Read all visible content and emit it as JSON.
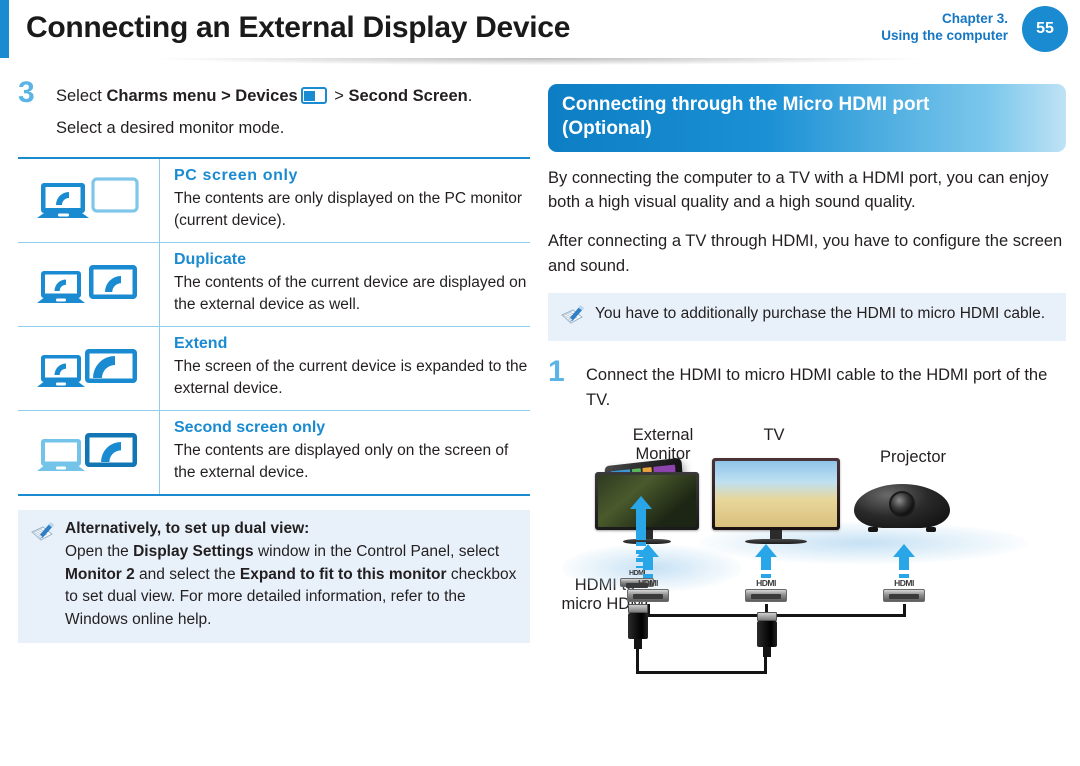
{
  "header": {
    "title": "Connecting an External Display Device",
    "chapter_line1": "Chapter 3.",
    "chapter_line2": "Using the computer",
    "page_number": "55",
    "accent_color": "#1a8bd0"
  },
  "left": {
    "step": {
      "number": "3",
      "line1_a": "Select ",
      "line1_b": "Charms menu > Devices",
      "line1_icon": "devices-icon",
      "line1_c": " > ",
      "line1_d": "Second Screen",
      "line1_e": ".",
      "line2": "Select a desired monitor mode."
    },
    "modes": [
      {
        "icon": "pc-screen-only-icon",
        "title": "PC screen only",
        "desc": "The contents are only displayed on the PC monitor (current device)."
      },
      {
        "icon": "duplicate-icon",
        "title": "Duplicate",
        "desc": "The contents of the current device are displayed on the external device as well."
      },
      {
        "icon": "extend-icon",
        "title": "Extend",
        "desc": "The screen of the current device is expanded to the external device."
      },
      {
        "icon": "second-screen-only-icon",
        "title": "Second screen only",
        "desc": "The contents are displayed only on the screen of the external device."
      }
    ],
    "tip": {
      "icon": "note-pencil-icon",
      "title": "Alternatively, to set up dual view:",
      "text_1": "Open the ",
      "text_b1": "Display Settings",
      "text_2": " window in the Control Panel, select ",
      "text_b2": "Monitor 2",
      "text_3": " and select the ",
      "text_b3": "Expand to fit to this monitor",
      "text_4": " checkbox to set dual view. For more detailed information, refer to the Windows online help."
    }
  },
  "right": {
    "heading_line1": "Connecting through the Micro HDMI port",
    "heading_line2": "(Optional)",
    "paragraph1": "By connecting the computer to a TV with a HDMI port, you can enjoy both a high visual quality and a high sound quality.",
    "paragraph2": "After connecting a TV through HDMI, you have to configure the screen and sound.",
    "tip": {
      "icon": "note-pencil-icon",
      "text": "You have to additionally purchase the HDMI to micro HDMI cable."
    },
    "step": {
      "number": "1",
      "text": "Connect the HDMI to micro HDMI cable to the HDMI port of the TV."
    },
    "illustration": {
      "label_external_monitor_line1": "External",
      "label_external_monitor_line2": "Monitor",
      "label_tv": "TV",
      "label_projector": "Projector",
      "label_cable_line1": "HDMI to",
      "label_cable_line2": "micro HDMI",
      "hdmi_port_label": "HDMI"
    }
  }
}
